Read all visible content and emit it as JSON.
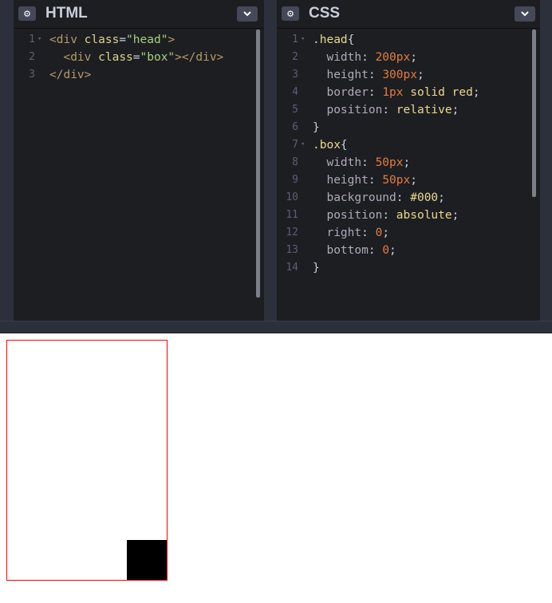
{
  "html_panel": {
    "title": "HTML",
    "lines": [
      {
        "n": "1",
        "fold": "▾",
        "parts": [
          [
            "tag",
            "<div "
          ],
          [
            "attr",
            "class"
          ],
          [
            "pun",
            "="
          ],
          [
            "str",
            "\"head\""
          ],
          [
            "tag",
            ">"
          ]
        ]
      },
      {
        "n": "2",
        "fold": "",
        "parts": [
          [
            "pun",
            "  "
          ],
          [
            "tag",
            "<div "
          ],
          [
            "attr",
            "class"
          ],
          [
            "pun",
            "="
          ],
          [
            "str",
            "\"box\""
          ],
          [
            "tag",
            "></div>"
          ]
        ]
      },
      {
        "n": "3",
        "fold": "",
        "parts": [
          [
            "tag",
            "</div>"
          ]
        ]
      }
    ]
  },
  "css_panel": {
    "title": "CSS",
    "lines": [
      {
        "n": "1",
        "fold": "▾",
        "parts": [
          [
            "sel",
            ".head"
          ],
          [
            "pun",
            "{"
          ]
        ]
      },
      {
        "n": "2",
        "fold": "",
        "parts": [
          [
            "prop",
            "  width"
          ],
          [
            "pun",
            ": "
          ],
          [
            "num",
            "200px"
          ],
          [
            "pun",
            ";"
          ]
        ]
      },
      {
        "n": "3",
        "fold": "",
        "parts": [
          [
            "prop",
            "  height"
          ],
          [
            "pun",
            ": "
          ],
          [
            "num",
            "300px"
          ],
          [
            "pun",
            ";"
          ]
        ]
      },
      {
        "n": "4",
        "fold": "",
        "parts": [
          [
            "prop",
            "  border"
          ],
          [
            "pun",
            ": "
          ],
          [
            "num",
            "1px"
          ],
          [
            "val",
            " solid red"
          ],
          [
            "pun",
            ";"
          ]
        ]
      },
      {
        "n": "5",
        "fold": "",
        "parts": [
          [
            "prop",
            "  position"
          ],
          [
            "pun",
            ": "
          ],
          [
            "val",
            "relative"
          ],
          [
            "pun",
            ";"
          ]
        ]
      },
      {
        "n": "6",
        "fold": "",
        "parts": [
          [
            "pun",
            "}"
          ]
        ]
      },
      {
        "n": "7",
        "fold": "▾",
        "parts": [
          [
            "sel",
            ".box"
          ],
          [
            "pun",
            "{"
          ]
        ]
      },
      {
        "n": "8",
        "fold": "",
        "parts": [
          [
            "prop",
            "  width"
          ],
          [
            "pun",
            ": "
          ],
          [
            "num",
            "50px"
          ],
          [
            "pun",
            ";"
          ]
        ]
      },
      {
        "n": "9",
        "fold": "",
        "parts": [
          [
            "prop",
            "  height"
          ],
          [
            "pun",
            ": "
          ],
          [
            "num",
            "50px"
          ],
          [
            "pun",
            ";"
          ]
        ]
      },
      {
        "n": "10",
        "fold": "",
        "parts": [
          [
            "prop",
            "  background"
          ],
          [
            "pun",
            ": "
          ],
          [
            "val",
            "#000"
          ],
          [
            "pun",
            ";"
          ]
        ]
      },
      {
        "n": "11",
        "fold": "",
        "parts": [
          [
            "prop",
            "  position"
          ],
          [
            "pun",
            ": "
          ],
          [
            "val",
            "absolute"
          ],
          [
            "pun",
            ";"
          ]
        ]
      },
      {
        "n": "12",
        "fold": "",
        "parts": [
          [
            "prop",
            "  right"
          ],
          [
            "pun",
            ": "
          ],
          [
            "num",
            "0"
          ],
          [
            "pun",
            ";"
          ]
        ]
      },
      {
        "n": "13",
        "fold": "",
        "parts": [
          [
            "prop",
            "  bottom"
          ],
          [
            "pun",
            ": "
          ],
          [
            "num",
            "0"
          ],
          [
            "pun",
            ";"
          ]
        ]
      },
      {
        "n": "14",
        "fold": "",
        "parts": [
          [
            "pun",
            "}"
          ]
        ]
      }
    ]
  },
  "icons": {
    "settings": "gear-icon",
    "collapse": "chevron-down-icon"
  },
  "colors": {
    "editor_bg": "#1d1e22",
    "chrome_bg": "#2c303a",
    "demo_border": "#ff0000",
    "demo_box": "#000000"
  }
}
